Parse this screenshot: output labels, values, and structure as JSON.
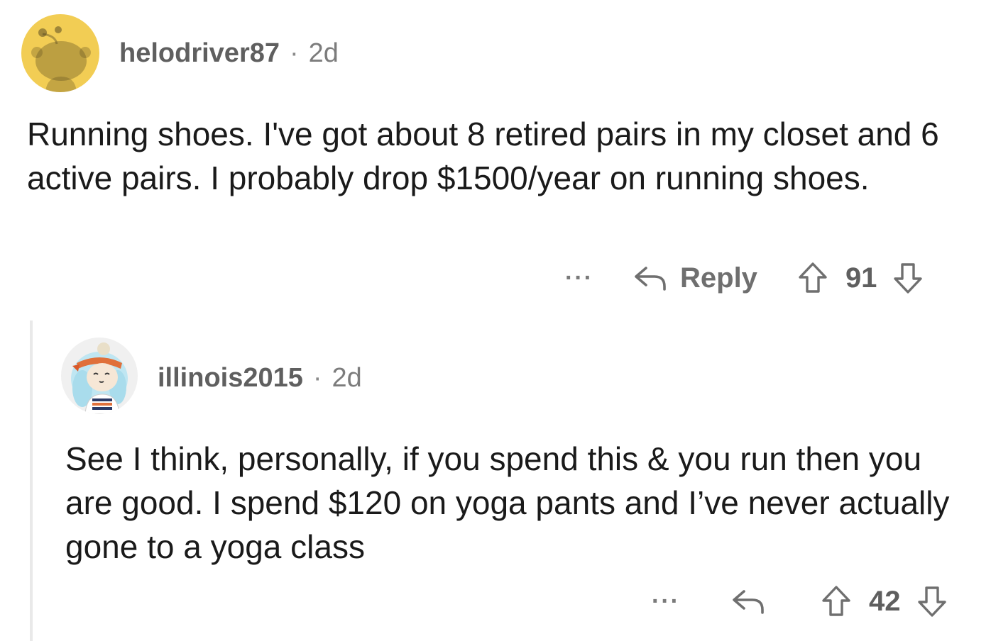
{
  "comments": [
    {
      "username": "helodriver87",
      "separator": "·",
      "age": "2d",
      "avatar_icon": "snoo-avatar-icon",
      "avatar_bg": "#f2cd54",
      "text": "Running shoes. I've got about 8 retired pairs in my closet and 6 active pairs. I probably drop $1500/year on running shoes.",
      "more_label": "···",
      "reply_label": "Reply",
      "score": "91"
    },
    {
      "username": "illinois2015",
      "separator": "·",
      "age": "2d",
      "avatar_icon": "character-avatar-icon",
      "text": "See I think, personally, if you spend this & you run then you are good. I spend $120 on yoga pants and I’ve never actually gone to a yoga class",
      "more_label": "···",
      "score": "42"
    }
  ],
  "colors": {
    "meta_text": "#7c7c7c",
    "body_text": "#1a1a1a",
    "thread_line": "#e9e9e9"
  }
}
